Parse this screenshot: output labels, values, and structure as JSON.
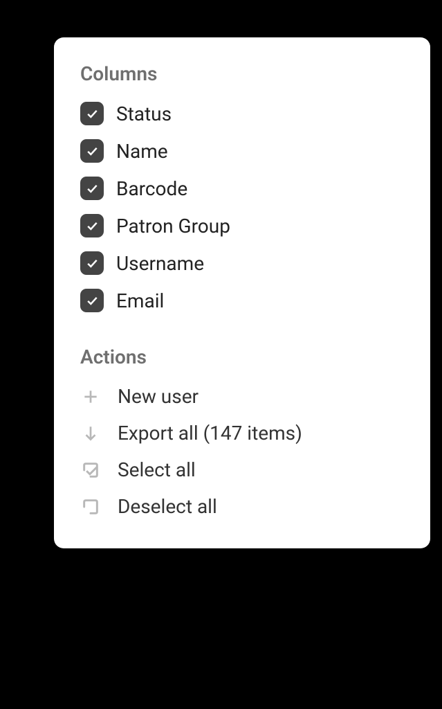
{
  "columns": {
    "heading": "Columns",
    "items": [
      {
        "label": "Status",
        "checked": true
      },
      {
        "label": "Name",
        "checked": true
      },
      {
        "label": "Barcode",
        "checked": true
      },
      {
        "label": "Patron Group",
        "checked": true
      },
      {
        "label": "Username",
        "checked": true
      },
      {
        "label": "Email",
        "checked": true
      }
    ]
  },
  "actions": {
    "heading": "Actions",
    "items": [
      {
        "icon": "plus",
        "label": "New user"
      },
      {
        "icon": "download",
        "label": "Export all (147 items)"
      },
      {
        "icon": "select-all",
        "label": "Select all"
      },
      {
        "icon": "deselect-all",
        "label": "Deselect all"
      }
    ]
  }
}
